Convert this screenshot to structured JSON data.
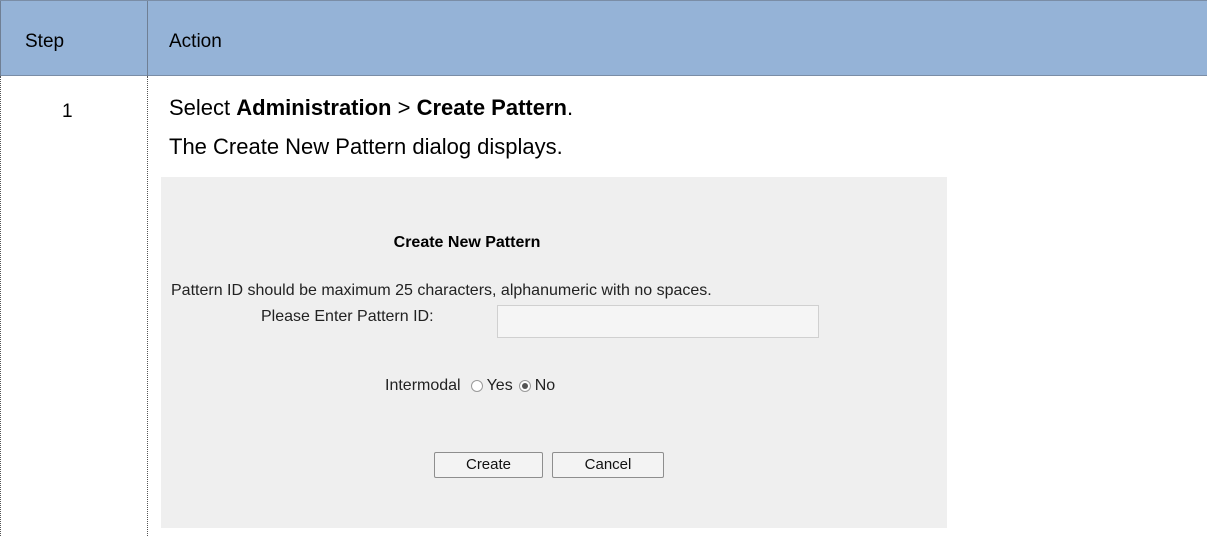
{
  "table": {
    "headers": {
      "step": "Step",
      "action": "Action"
    },
    "rows": [
      {
        "step": "1",
        "line1": {
          "prefix": "Select ",
          "menu": "Administration",
          "sep": " > ",
          "item": "Create Pattern",
          "suffix": "."
        },
        "line2": "The Create New Pattern dialog displays."
      }
    ]
  },
  "dialog": {
    "title": "Create New Pattern",
    "note": "Pattern ID should be maximum 25 characters, alphanumeric with no spaces.",
    "id_label": "Please Enter Pattern ID:",
    "id_value": "",
    "intermodal_label": "Intermodal",
    "options": [
      {
        "label": "Yes",
        "checked": false
      },
      {
        "label": "No",
        "checked": true
      }
    ],
    "create_label": "Create",
    "cancel_label": "Cancel"
  },
  "colors": {
    "header_bg": "#95b3d7",
    "dialog_bg": "#efefef"
  }
}
